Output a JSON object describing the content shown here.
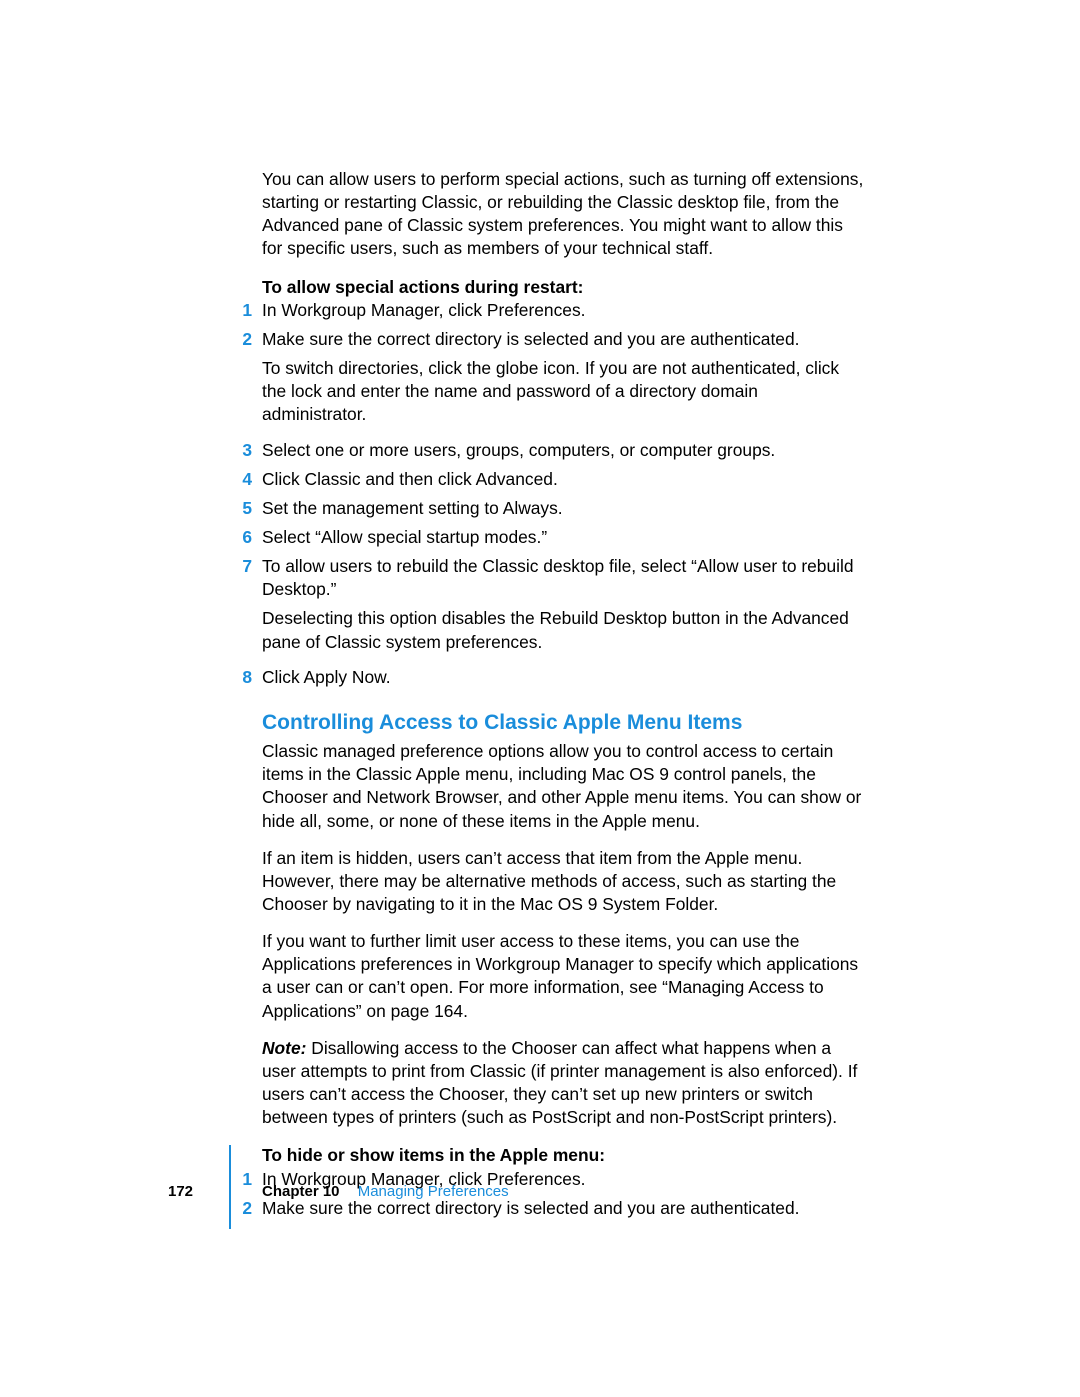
{
  "intro_para": "You can allow users to perform special actions, such as turning off extensions, starting or restarting Classic, or rebuilding the Classic desktop file, from the Advanced pane of Classic system preferences. You might want to allow this for specific users, such as members of your technical staff.",
  "section1": {
    "subhead": "To allow special actions during restart:",
    "steps": [
      {
        "n": "1",
        "text": "In Workgroup Manager, click Preferences."
      },
      {
        "n": "2",
        "text": "Make sure the correct directory is selected and you are authenticated.",
        "extra": "To switch directories, click the globe icon. If you are not authenticated, click the lock and enter the name and password of a directory domain administrator."
      },
      {
        "n": "3",
        "text": "Select one or more users, groups, computers, or computer groups."
      },
      {
        "n": "4",
        "text": "Click Classic and then click Advanced."
      },
      {
        "n": "5",
        "text": "Set the management setting to Always."
      },
      {
        "n": "6",
        "text": "Select “Allow special startup modes.”"
      },
      {
        "n": "7",
        "text": "To allow users to rebuild the Classic desktop file, select “Allow user to rebuild Desktop.”",
        "extra": "Deselecting this option disables the Rebuild Desktop button in the Advanced pane of Classic system preferences."
      },
      {
        "n": "8",
        "text": "Click Apply Now."
      }
    ]
  },
  "section2": {
    "heading": "Controlling Access to Classic Apple Menu Items",
    "para1": "Classic managed preference options allow you to control access to certain items in the Classic Apple menu, including Mac OS 9 control panels, the Chooser and Network Browser, and other Apple menu items. You can show or hide all, some, or none of these items in the Apple menu.",
    "para2": "If an item is hidden, users can’t access that item from the Apple menu. However, there may be alternative methods of access, such as starting the Chooser by navigating to it in the Mac OS 9 System Folder.",
    "para3": "If you want to further limit user access to these items, you can use the Applications preferences in Workgroup Manager to specify which applications a user can or can’t open. For more information, see “Managing Access to Applications” on page 164.",
    "note_label": "Note:  ",
    "para4": "Disallowing access to the Chooser can affect what happens when a user attempts to print from Classic (if printer management is also enforced). If users can’t access the Chooser, they can’t set up new printers or switch between types of printers (such as PostScript and non-PostScript printers).",
    "subhead": "To hide or show items in the Apple menu:",
    "steps": [
      {
        "n": "1",
        "text": "In Workgroup Manager, click Preferences."
      },
      {
        "n": "2",
        "text": "Make sure the correct directory is selected and you are authenticated."
      }
    ]
  },
  "footer": {
    "page_number": "172",
    "chapter_label": "Chapter 10",
    "chapter_title": "Managing Preferences"
  }
}
